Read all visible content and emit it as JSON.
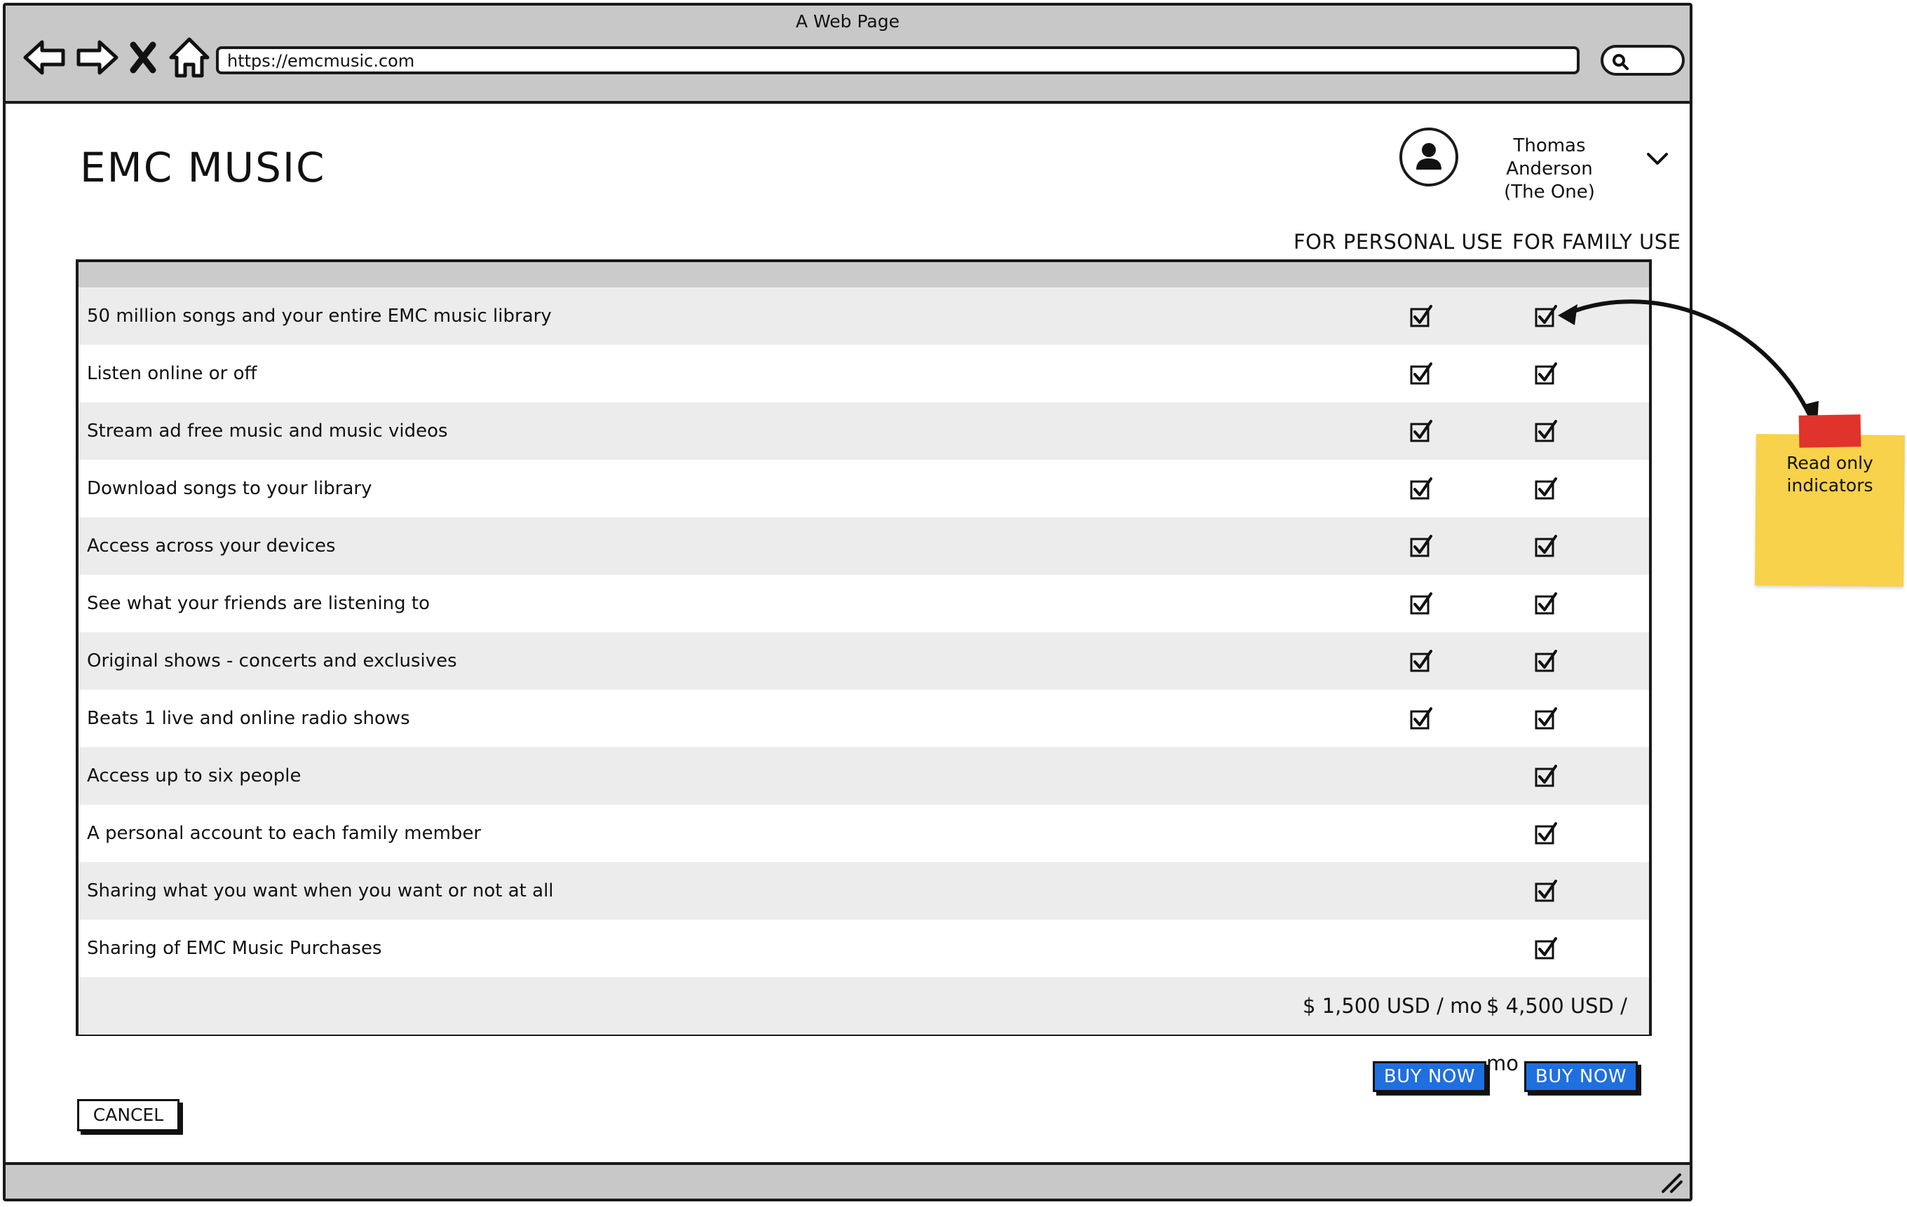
{
  "window": {
    "title": "A Web Page",
    "url": "https://emcmusic.com"
  },
  "nav_icons": [
    "back-arrow-icon",
    "forward-arrow-icon",
    "close-icon",
    "home-icon"
  ],
  "app": {
    "title": "EMC MUSIC"
  },
  "user": {
    "name": "Thomas Anderson",
    "subtitle": "(The One)"
  },
  "columns": {
    "personal": "FOR PERSONAL USE",
    "family": "FOR FAMILY USE"
  },
  "features": [
    {
      "label": "50 million songs and your entire EMC music library",
      "personal": true,
      "family": true
    },
    {
      "label": "Listen online or off",
      "personal": true,
      "family": true
    },
    {
      "label": "Stream ad free music and music videos",
      "personal": true,
      "family": true
    },
    {
      "label": "Download songs to your library",
      "personal": true,
      "family": true
    },
    {
      "label": "Access across your devices",
      "personal": true,
      "family": true
    },
    {
      "label": "See what your friends are listening to",
      "personal": true,
      "family": true
    },
    {
      "label": "Original shows - concerts and exclusives",
      "personal": true,
      "family": true
    },
    {
      "label": "Beats 1 live and online radio shows",
      "personal": true,
      "family": true
    },
    {
      "label": "Access up to six people",
      "personal": false,
      "family": true
    },
    {
      "label": "A personal account to each family member",
      "personal": false,
      "family": true
    },
    {
      "label": "Sharing what you want when you want or not at all",
      "personal": false,
      "family": true
    },
    {
      "label": "Sharing of EMC Music Purchases",
      "personal": false,
      "family": true
    }
  ],
  "prices": {
    "personal": "$ 1,500 USD / mo",
    "family": "$ 4,500 USD / mo"
  },
  "buttons": {
    "buy_personal": "BUY NOW",
    "buy_family": "BUY NOW",
    "cancel": "CANCEL"
  },
  "annotation": {
    "line1": "Read only",
    "line2": "indicators"
  },
  "colors": {
    "buy_button": "#1e6fe0",
    "sticky_note": "#f7d24a",
    "sticky_tape": "#e0332b",
    "chrome_gray": "#c8c8c8",
    "row_shade": "#ececec"
  }
}
